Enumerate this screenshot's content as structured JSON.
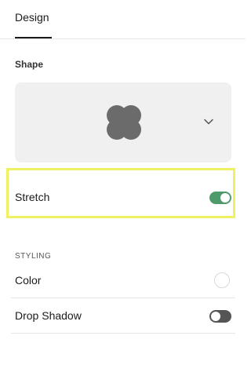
{
  "tabs": [
    {
      "label": "Design",
      "active": true
    }
  ],
  "shape": {
    "label": "Shape",
    "selected_icon": "quatrefoil-shape-icon",
    "dropdown_icon": "chevron-down-icon",
    "preview_color": "#6b6b6b"
  },
  "stretch": {
    "label": "Stretch",
    "on": true,
    "highlighted": true,
    "highlight_color": "#eef262"
  },
  "styling": {
    "section_label": "STYLING",
    "color": {
      "label": "Color",
      "value": "#ffffff"
    },
    "drop_shadow": {
      "label": "Drop Shadow",
      "on": false
    }
  },
  "colors": {
    "toggle_on": "#4e9a6b",
    "toggle_off": "#555555",
    "text": "#1a1a1a",
    "picker_bg": "#f0f0f0"
  }
}
